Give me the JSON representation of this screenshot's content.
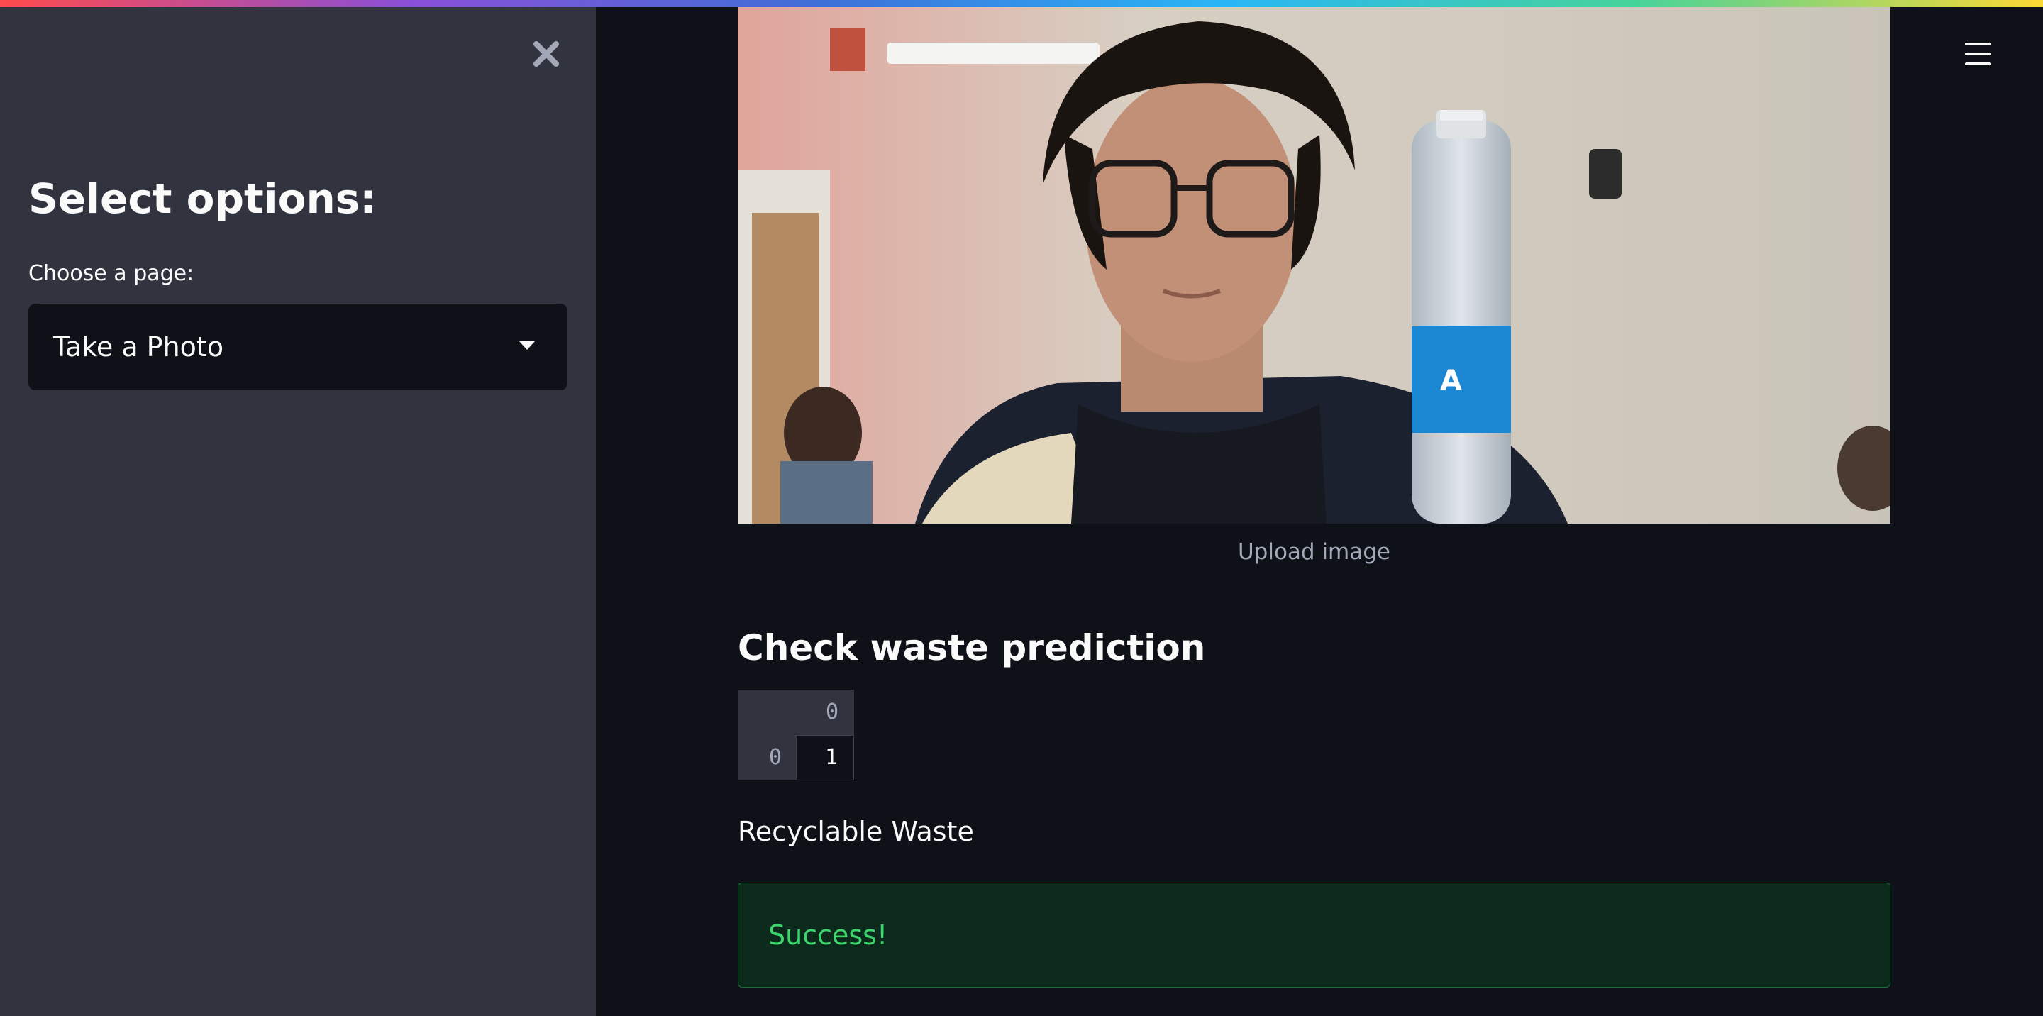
{
  "sidebar": {
    "close_icon": "close-icon",
    "heading": "Select options:",
    "page_select_label": "Choose a page:",
    "page_select_value": "Take a Photo",
    "caret_icon": "chevron-down-icon"
  },
  "header": {
    "menu_icon": "hamburger-menu-icon"
  },
  "main": {
    "image_caption": "Upload image",
    "section_title": "Check waste prediction",
    "prediction_table": {
      "column_headers": [
        "0"
      ],
      "row_headers": [
        "0"
      ],
      "cells": [
        [
          "1"
        ]
      ]
    },
    "result_text": "Recyclable Waste",
    "alert_text": "Success!"
  },
  "colors": {
    "background": "#0e1117",
    "sidebar": "#31333f",
    "success_bg": "#0b2a1b",
    "success_text": "#3dd56d"
  }
}
